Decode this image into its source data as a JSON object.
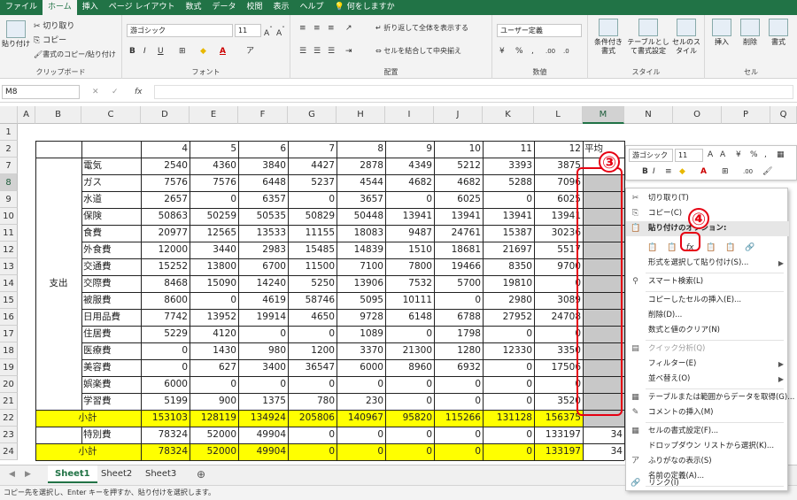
{
  "ribbon_tabs": [
    "ファイル",
    "ホーム",
    "挿入",
    "ページ レイアウト",
    "数式",
    "データ",
    "校閲",
    "表示",
    "ヘルプ",
    "何をしますか"
  ],
  "clipboard": {
    "paste": "貼り付け",
    "cut": "切り取り",
    "copy": "コピー",
    "format_painter": "書式のコピー/貼り付け",
    "label": "クリップボード"
  },
  "font": {
    "name": "游ゴシック",
    "size": "11",
    "label": "フォント"
  },
  "alignment": {
    "wrap": "折り返して全体を表示する",
    "merge": "セルを結合して中央揃え",
    "label": "配置"
  },
  "number": {
    "format": "ユーザー定義",
    "label": "数値"
  },
  "styles": {
    "conditional": "条件付き書式",
    "table": "テーブルとして書式設定",
    "cell": "セルのスタイル",
    "label": "スタイル"
  },
  "cells": {
    "insert": "挿入",
    "delete": "削除",
    "format": "書式",
    "label": "セル"
  },
  "formula": {
    "namebox": "M8",
    "fx": "fx"
  },
  "columns": [
    "A",
    "B",
    "C",
    "D",
    "E",
    "F",
    "G",
    "H",
    "I",
    "J",
    "K",
    "L",
    "M",
    "N",
    "O",
    "P",
    "Q"
  ],
  "header_row": {
    "num": "2",
    "months": [
      "4",
      "5",
      "6",
      "7",
      "8",
      "9",
      "10",
      "11",
      "12"
    ],
    "m_label": "平均"
  },
  "section_label": "支出",
  "rows": [
    {
      "num": "7",
      "name": "電気",
      "values": [
        "2540",
        "4360",
        "3840",
        "4427",
        "2878",
        "4349",
        "5212",
        "3393",
        "3875"
      ]
    },
    {
      "num": "8",
      "name": "ガス",
      "values": [
        "7576",
        "7576",
        "6448",
        "5237",
        "4544",
        "4682",
        "4682",
        "5288",
        "7096"
      ]
    },
    {
      "num": "9",
      "name": "水道",
      "values": [
        "2657",
        "0",
        "6357",
        "0",
        "3657",
        "0",
        "6025",
        "0",
        "6025"
      ]
    },
    {
      "num": "10",
      "name": "保険",
      "values": [
        "50863",
        "50259",
        "50535",
        "50829",
        "50448",
        "13941",
        "13941",
        "13941",
        "13941"
      ]
    },
    {
      "num": "11",
      "name": "食費",
      "values": [
        "20977",
        "12565",
        "13533",
        "11155",
        "18083",
        "9487",
        "24761",
        "15387",
        "30236"
      ]
    },
    {
      "num": "12",
      "name": "外食費",
      "values": [
        "12000",
        "3440",
        "2983",
        "15485",
        "14839",
        "1510",
        "18681",
        "21697",
        "5517"
      ]
    },
    {
      "num": "13",
      "name": "交通費",
      "values": [
        "15252",
        "13800",
        "6700",
        "11500",
        "7100",
        "7800",
        "19466",
        "8350",
        "9700"
      ]
    },
    {
      "num": "14",
      "name": "交際費",
      "values": [
        "8468",
        "15090",
        "14240",
        "5250",
        "13906",
        "7532",
        "5700",
        "19810",
        "0"
      ]
    },
    {
      "num": "15",
      "name": "被服費",
      "values": [
        "8600",
        "0",
        "4619",
        "58746",
        "5095",
        "10111",
        "0",
        "2980",
        "3089"
      ]
    },
    {
      "num": "16",
      "name": "日用品費",
      "values": [
        "7742",
        "13952",
        "19914",
        "4650",
        "9728",
        "6148",
        "6788",
        "27952",
        "24708"
      ]
    },
    {
      "num": "17",
      "name": "住居費",
      "values": [
        "5229",
        "4120",
        "0",
        "0",
        "1089",
        "0",
        "1798",
        "0",
        "0"
      ]
    },
    {
      "num": "18",
      "name": "医療費",
      "values": [
        "0",
        "1430",
        "980",
        "1200",
        "3370",
        "21300",
        "1280",
        "12330",
        "3350"
      ]
    },
    {
      "num": "19",
      "name": "美容費",
      "values": [
        "0",
        "627",
        "3400",
        "36547",
        "6000",
        "8960",
        "6932",
        "0",
        "17506"
      ]
    },
    {
      "num": "20",
      "name": "娯楽費",
      "values": [
        "6000",
        "0",
        "0",
        "0",
        "0",
        "0",
        "0",
        "0",
        "0"
      ]
    },
    {
      "num": "21",
      "name": "学習費",
      "values": [
        "5199",
        "900",
        "1375",
        "780",
        "230",
        "0",
        "0",
        "0",
        "3520"
      ]
    }
  ],
  "subtotal_row": {
    "num": "22",
    "label": "小計",
    "values": [
      "153103",
      "128119",
      "134924",
      "205806",
      "140967",
      "95820",
      "115266",
      "131128",
      "156375"
    ]
  },
  "special_row": {
    "num": "23",
    "name": "特別費",
    "values": [
      "78324",
      "52000",
      "49904",
      "0",
      "0",
      "0",
      "0",
      "0",
      "133197"
    ],
    "m": "34"
  },
  "subtotal2_row": {
    "num": "24",
    "label": "小計",
    "values": [
      "78324",
      "52000",
      "49904",
      "0",
      "0",
      "0",
      "0",
      "0",
      "133197"
    ],
    "m": "34"
  },
  "sheet_tabs": [
    "Sheet1",
    "Sheet2",
    "Sheet3"
  ],
  "status": "コピー先を選択し、Enter キーを押すか、貼り付けを選択します。",
  "mini_toolbar": {
    "font": "游ゴシック",
    "size": "11"
  },
  "context_menu": {
    "cut": "切り取り(T)",
    "copy": "コピー(C)",
    "paste_options": "貼り付けのオプション:",
    "paste_special": "形式を選択して貼り付け(S)...",
    "smart_lookup": "スマート検索(L)",
    "insert_copied": "コピーしたセルの挿入(E)...",
    "delete": "削除(D)...",
    "clear": "数式と値のクリア(N)",
    "quick_analysis": "クイック分析(Q)",
    "filter": "フィルター(E)",
    "sort": "並べ替え(O)",
    "table_data": "テーブルまたは範囲からデータを取得(G)...",
    "comment": "コメントの挿入(M)",
    "format_cells": "セルの書式設定(F)...",
    "dropdown": "ドロップダウン リストから選択(K)...",
    "furigana": "ふりがなの表示(S)",
    "define_name": "名前の定義(A)...",
    "link": "リンク(I)"
  },
  "annotations": {
    "a3": "③",
    "a4": "④"
  },
  "colors": {
    "excel_green": "#217346",
    "subtotal_yellow": "#ffff00",
    "selection_gray": "#c8c8c8",
    "annotation_red": "#e60012"
  }
}
